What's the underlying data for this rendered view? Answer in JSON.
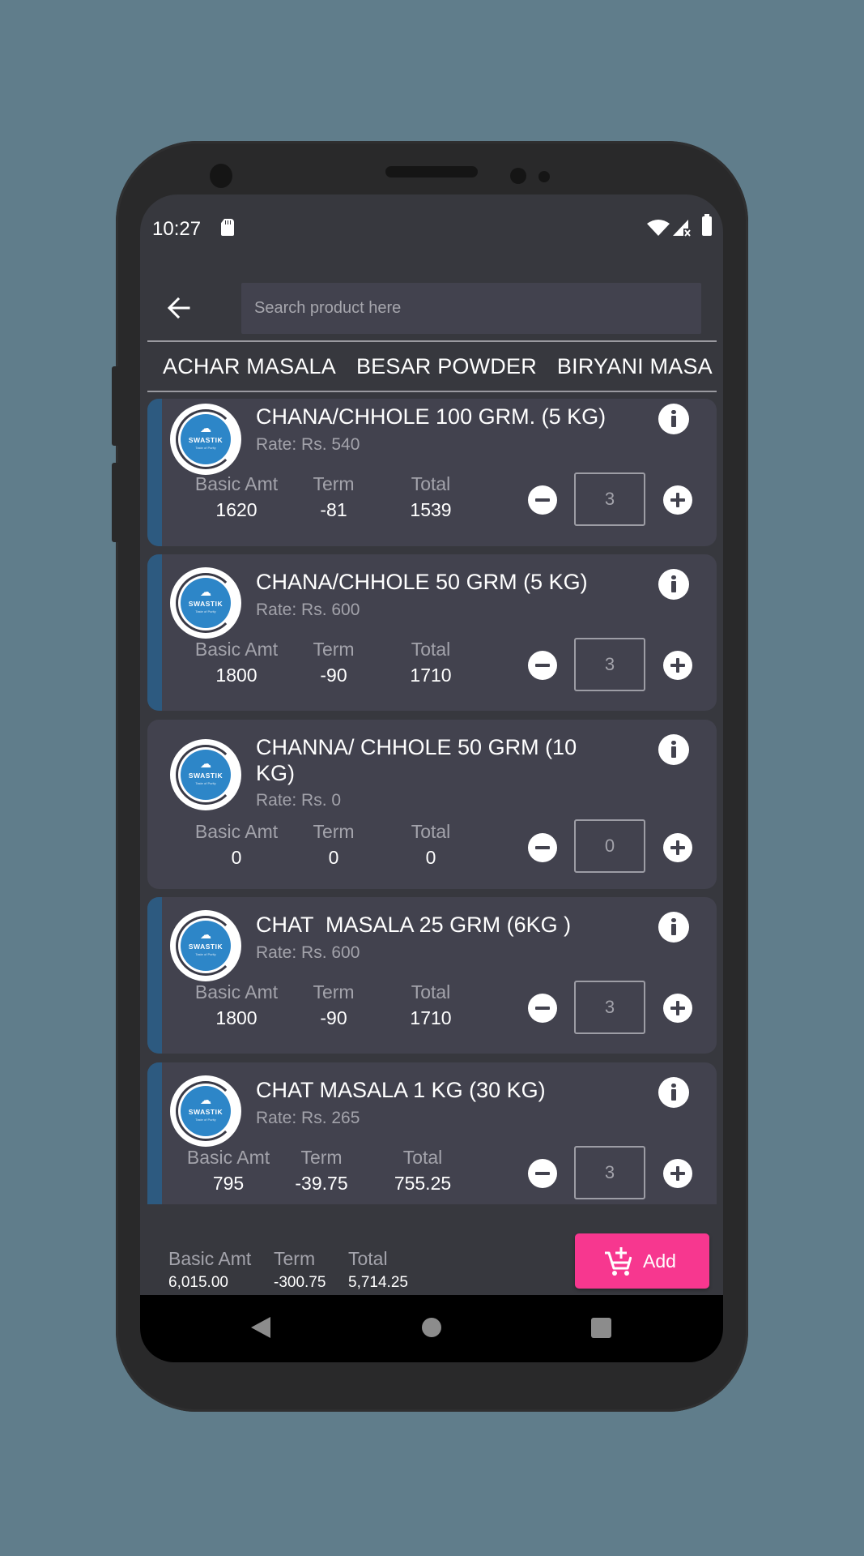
{
  "status_bar": {
    "time": "10:27",
    "icons": [
      "sd-card-icon",
      "wifi-icon",
      "signal-no-data-icon",
      "battery-icon"
    ]
  },
  "header": {
    "back_icon": "arrow-left-icon",
    "search_placeholder": "Search product here",
    "search_value": ""
  },
  "categories": [
    "ACHAR MASALA",
    "BESAR POWDER",
    "BIRYANI MASALA"
  ],
  "labels": {
    "basic_amt": "Basic Amt",
    "term": "Term",
    "total": "Total",
    "logo_brand": "SWASTIK",
    "logo_tagline": "Taste of Purity"
  },
  "products": [
    {
      "name": "CHANA/CHHOLE 100 GRM. (5 KG)",
      "rate": "Rate: Rs. 540",
      "basic_amt": "1620",
      "term": "-81",
      "total": "1539",
      "qty": "3",
      "selected": true
    },
    {
      "name": "CHANA/CHHOLE 50 GRM (5 KG)",
      "rate": "Rate: Rs. 600",
      "basic_amt": "1800",
      "term": "-90",
      "total": "1710",
      "qty": "3",
      "selected": true
    },
    {
      "name": "CHANNA/ CHHOLE 50 GRM (10 KG)",
      "rate": "Rate: Rs. 0",
      "basic_amt": "0",
      "term": "0",
      "total": "0",
      "qty": "0",
      "selected": false
    },
    {
      "name": "CHAT  MASALA 25 GRM (6KG )",
      "rate": "Rate: Rs. 600",
      "basic_amt": "1800",
      "term": "-90",
      "total": "1710",
      "qty": "3",
      "selected": true
    },
    {
      "name": "CHAT MASALA 1 KG (30 KG)",
      "rate": "Rate: Rs. 265",
      "basic_amt": "795",
      "term": "-39.75",
      "total": "755.25",
      "qty": "3",
      "selected": true
    }
  ],
  "summary": {
    "basic_amt_label": "Basic Amt",
    "basic_amt": "6,015.00",
    "term_label": "Term",
    "term": "-300.75",
    "total_label": "Total",
    "total": "5,714.25",
    "add_label": "Add"
  },
  "colors": {
    "background": "#607d8b",
    "accent_selected": "#2d5a80",
    "add_button": "#f7378f",
    "card": "#42424e",
    "screen": "#37383e"
  }
}
